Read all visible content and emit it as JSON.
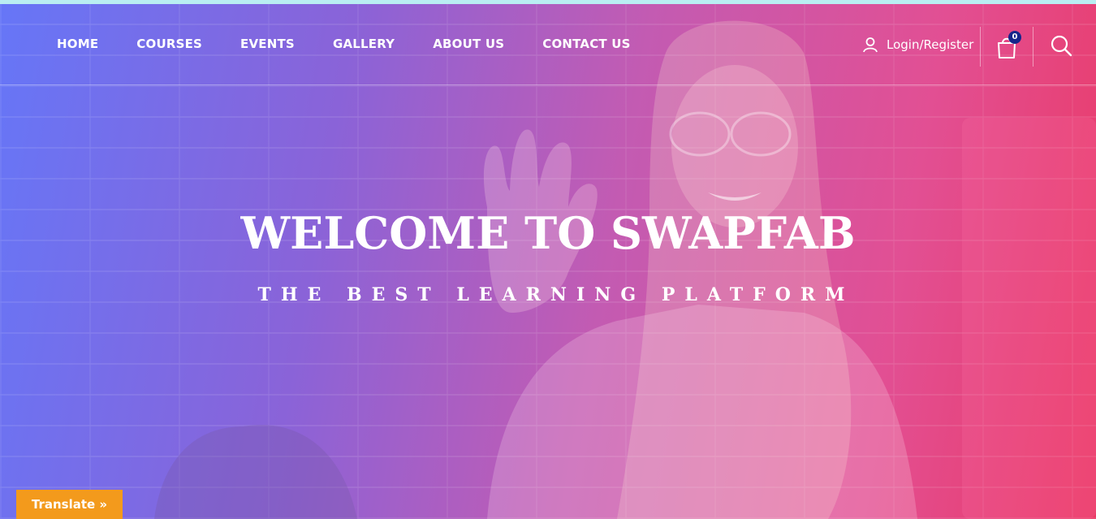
{
  "nav": {
    "items": [
      "HOME",
      "COURSES",
      "EVENTS",
      "GALLERY",
      "ABOUT US",
      "CONTACT US"
    ],
    "login_label": "Login/Register",
    "cart_count": "0",
    "icons": {
      "user": "user-icon",
      "cart": "shopping-bag-icon",
      "search": "search-icon"
    }
  },
  "hero": {
    "title": "WELCOME TO SWAPFAB",
    "subtitle": "THE BEST LEARNING PLATFORM"
  },
  "translate": {
    "label": "Translate »"
  },
  "colors": {
    "gradient_start": "#6676f7",
    "gradient_end": "#ea3a66",
    "translate_bg": "#f39a1c",
    "badge_bg": "#16258a"
  }
}
